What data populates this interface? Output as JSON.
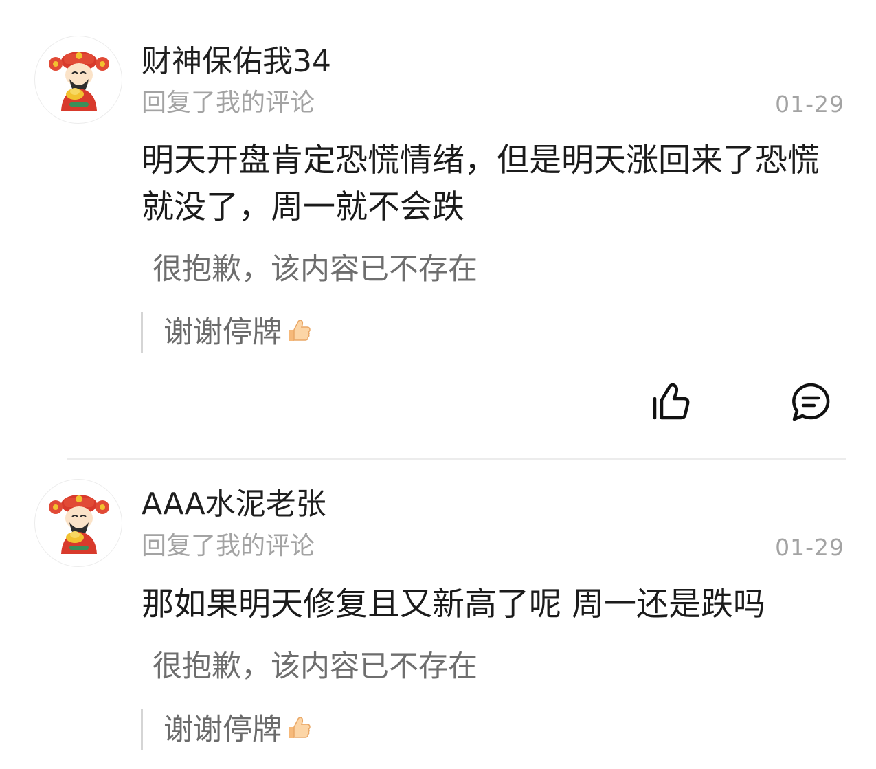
{
  "comments": [
    {
      "username": "财神保佑我34",
      "action": "回复了我的评论",
      "date": "01-29",
      "body": "明天开盘肯定恐慌情绪，但是明天涨回来了恐慌就没了，周一就不会跌",
      "deleted_notice": "很抱歉，该内容已不存在",
      "quote": "谢谢停牌",
      "avatar_icon": "caishen-avatar-icon",
      "quote_emoji": "thumbs-up-icon"
    },
    {
      "username": "AAA水泥老张",
      "action": "回复了我的评论",
      "date": "01-29",
      "body": "那如果明天修复且又新高了呢 周一还是跌吗",
      "deleted_notice": "很抱歉，该内容已不存在",
      "quote": "谢谢停牌",
      "avatar_icon": "caishen-avatar-icon",
      "quote_emoji": "thumbs-up-icon"
    }
  ],
  "actions": {
    "like_icon": "like-icon",
    "reply_icon": "comment-bubble-icon"
  },
  "colors": {
    "username": "#1f1f1f",
    "meta_gray": "#a3a3a3",
    "body": "#1b1b1b",
    "deleted_gray": "#6e6e6e",
    "quote_bar": "#d5d5d5",
    "divider": "#ececec"
  }
}
